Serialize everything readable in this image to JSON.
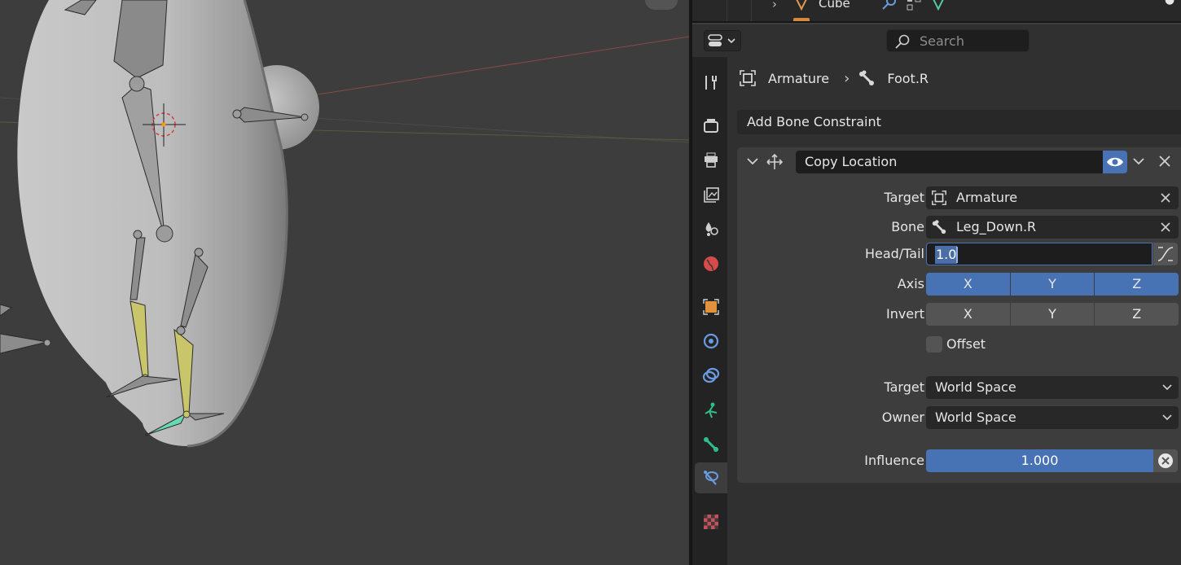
{
  "outliner": {
    "item_name": "Cube"
  },
  "header": {
    "search_placeholder": "Search"
  },
  "breadcrumb": {
    "object": "Armature",
    "bone": "Foot.R"
  },
  "add_constraint_label": "Add Bone Constraint",
  "constraint": {
    "name": "Copy Location",
    "target_label": "Target",
    "target_value": "Armature",
    "bone_label": "Bone",
    "bone_value": "Leg_Down.R",
    "headtail_label": "Head/Tail",
    "headtail_value": "1.0",
    "axis_label": "Axis",
    "axis": [
      "X",
      "Y",
      "Z"
    ],
    "axis_enabled": [
      true,
      true,
      true
    ],
    "invert_label": "Invert",
    "invert": [
      "X",
      "Y",
      "Z"
    ],
    "invert_enabled": [
      false,
      false,
      false
    ],
    "offset_label": "Offset",
    "offset_checked": false,
    "target_space_label": "Target",
    "target_space": "World Space",
    "owner_space_label": "Owner",
    "owner_space": "World Space",
    "influence_label": "Influence",
    "influence_value": "1.000",
    "enabled": true
  },
  "colors": {
    "accent": "#4772b3",
    "background": "#3d3d3d",
    "panel": "#303030"
  },
  "property_tabs": [
    "tool-icon",
    "render-icon",
    "output-icon",
    "view-layer-icon",
    "scene-icon",
    "world-icon",
    "object-icon",
    "modifiers-icon",
    "physics-icon",
    "object-constraints-icon",
    "object-data-icon",
    "bone-icon",
    "bone-constraints-icon",
    "texture-icon"
  ],
  "active_tab": "bone-constraints-icon"
}
